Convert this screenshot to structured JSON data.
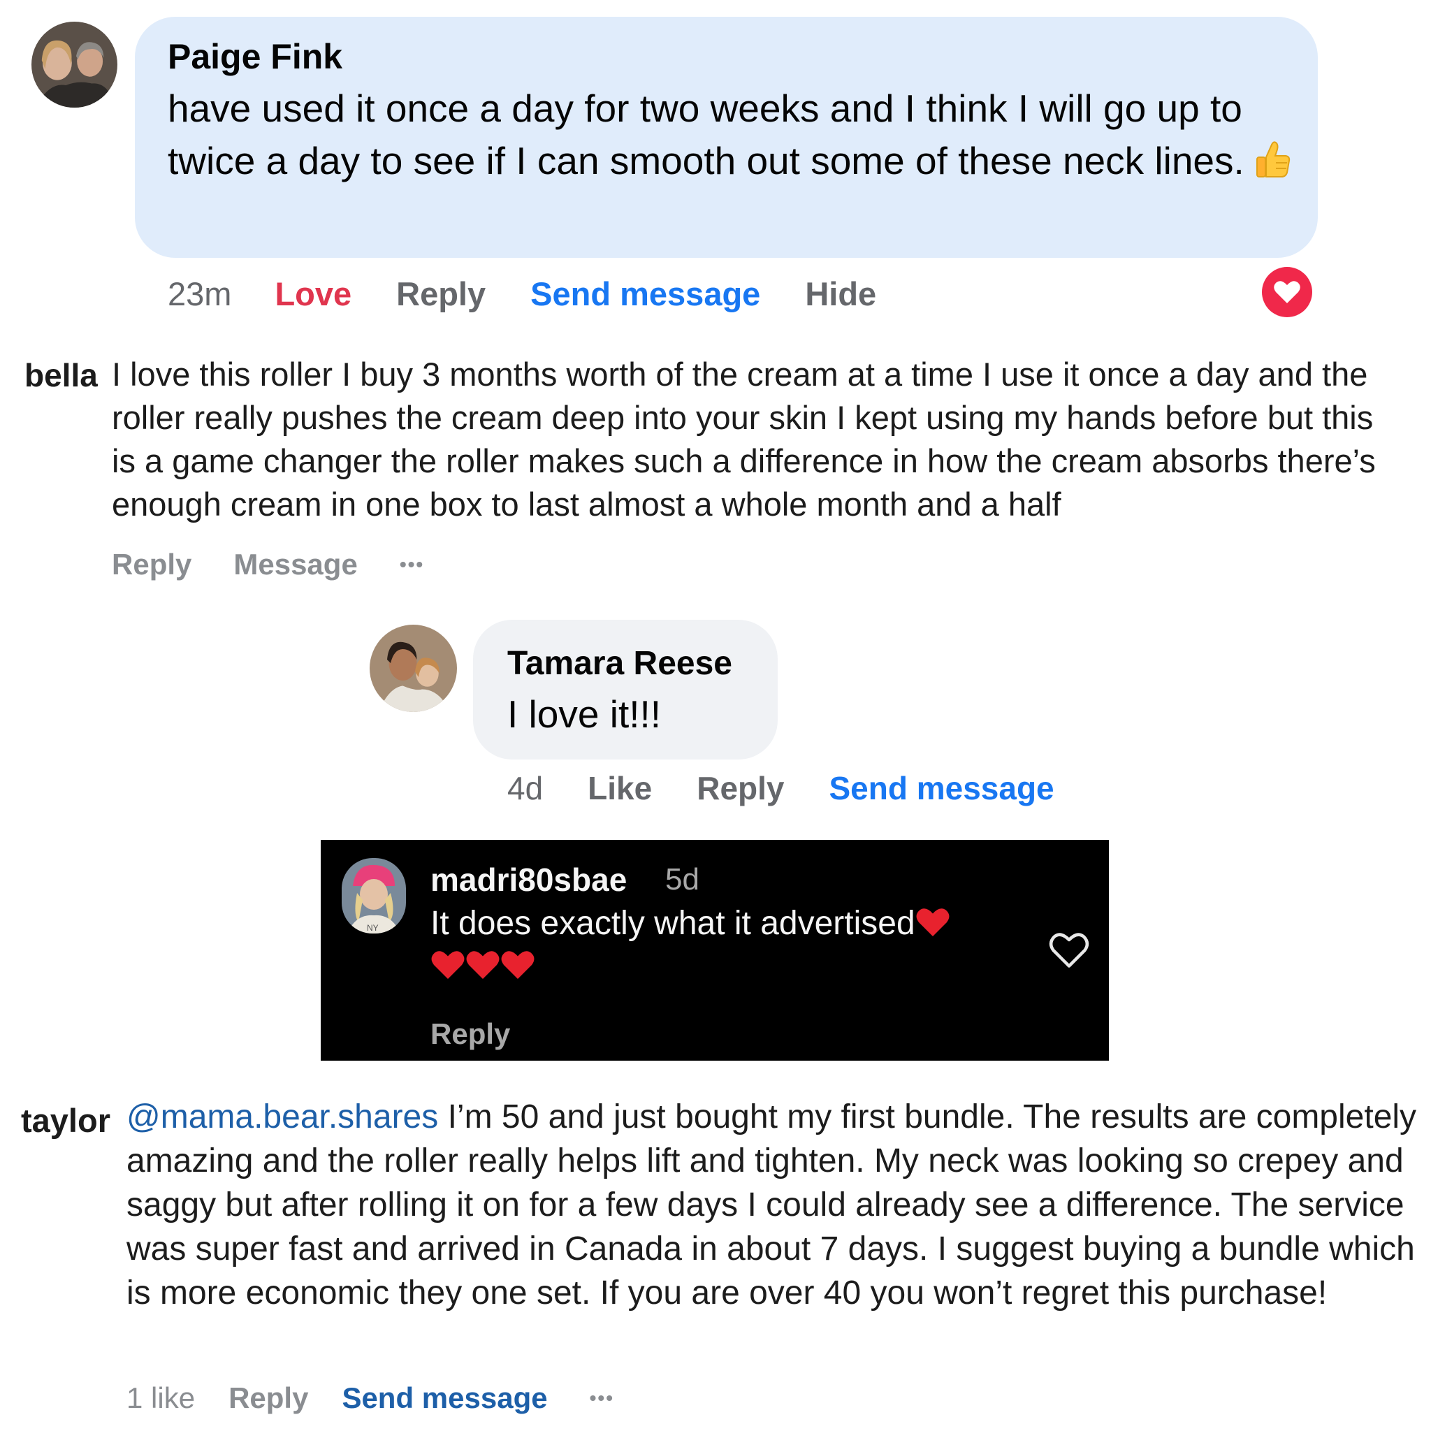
{
  "paige": {
    "name": "Paige Fink",
    "text": "have used it once a day for two weeks and I think I will go up to twice a day to see if I can smooth out some of these neck lines.",
    "time": "23m",
    "love_label": "Love",
    "reply_label": "Reply",
    "send_message_label": "Send message",
    "hide_label": "Hide",
    "emoji": "thumbs-up-icon",
    "reaction": "heart-icon"
  },
  "bella": {
    "name": "bella",
    "text": "I love this roller I buy 3 months worth of the cream at a time I use it once a day and the roller really pushes the cream deep into your skin I kept using my hands before but this is a game changer the roller makes such a difference in how the cream absorbs there’s enough cream in one box to last almost a whole month and a half",
    "reply_label": "Reply",
    "message_label": "Message",
    "more_label": "•••"
  },
  "tamara": {
    "name": "Tamara Reese",
    "text": "I love it!!!",
    "time": "4d",
    "like_label": "Like",
    "reply_label": "Reply",
    "send_message_label": "Send message"
  },
  "instagram": {
    "username": "madri80sbae",
    "time": "5d",
    "text": "It does exactly what it advertised",
    "hearts": [
      "red-heart-icon",
      "red-heart-icon",
      "red-heart-icon",
      "red-heart-icon"
    ],
    "reply_label": "Reply",
    "like_icon": "heart-outline-icon"
  },
  "taylor": {
    "name": "taylor",
    "mention": "@mama.bear.shares",
    "text": " I’m 50 and just bought my first bundle. The results are completely amazing and the roller really helps lift and tighten. My neck was looking so crepey and saggy but after rolling it on for a few days I could already see a difference. The service was super fast and arrived in Canada in about 7 days. I suggest buying a bundle which is more economic they one set. If you are over 40 you won’t regret this purchase!",
    "likes": "1 like",
    "reply_label": "Reply",
    "send_message_label": "Send message",
    "more_label": "•••"
  },
  "colors": {
    "facebook_blue": "#1877f2",
    "love_red": "#e0354e",
    "bubble_blue": "#e0ecfb",
    "bubble_gray": "#f0f2f5",
    "instagram_bg": "#000000"
  }
}
